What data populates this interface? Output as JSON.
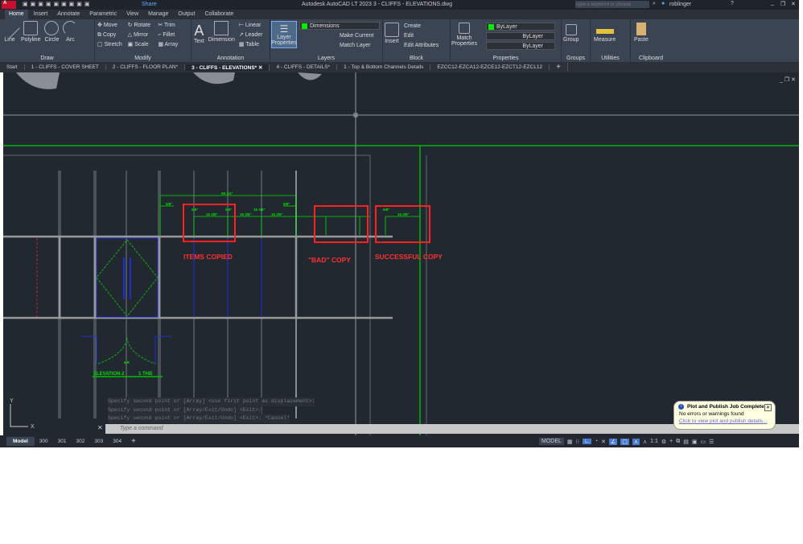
{
  "app": {
    "title": "Autodesk AutoCAD LT 2023   3 - CLIFFS - ELEVATIONS.dwg",
    "share": "Share",
    "search_placeholder": "Type a keyword or phrase",
    "user": "roblinger"
  },
  "ribbon_tabs": [
    "Home",
    "Insert",
    "Annotate",
    "Parametric",
    "View",
    "Manage",
    "Output",
    "Collaborate"
  ],
  "panels": {
    "draw": {
      "title": "Draw",
      "items": [
        "Line",
        "Polyline",
        "Circle",
        "Arc"
      ]
    },
    "modify": {
      "title": "Modify",
      "items": [
        "Move",
        "Rotate",
        "Trim",
        "Copy",
        "Mirror",
        "Fillet",
        "Stretch",
        "Scale",
        "Array"
      ]
    },
    "annotation": {
      "title": "Annotation",
      "items": [
        "Text",
        "Dimension",
        "Linear",
        "Leader",
        "Table"
      ]
    },
    "layers": {
      "title": "Layers",
      "layer_props": "Layer Properties",
      "current_layer": "Dimensions",
      "make_current": "Make Current",
      "match_layer": "Match Layer"
    },
    "block": {
      "title": "Block",
      "items": [
        "Insert",
        "Create",
        "Edit",
        "Edit Attributes"
      ]
    },
    "properties": {
      "title": "Properties",
      "match": "Match Properties",
      "color": "ByLayer",
      "linetype": "ByLayer",
      "lineweight": "ByLayer",
      "color_swatch": "#00e000"
    },
    "groups": {
      "title": "Groups",
      "group": "Group"
    },
    "utilities": {
      "title": "Utilities",
      "measure": "Measure"
    },
    "clipboard": {
      "title": "Clipboard",
      "paste": "Paste"
    }
  },
  "file_tabs": [
    "Start",
    "1 - CLIFFS - COVER SHEET",
    "2 - CLIFFS - FLOOR PLAN*",
    "3 - CLIFFS - ELEVATIONS*",
    "4 - CLIFFS - DETAILS*",
    "1 - Top & Bottom Channels Details",
    "EZCC12-EZCA12-EZCE12-EZCT12-EZCL12"
  ],
  "active_file_tab": 3,
  "drawing": {
    "annotations": {
      "items_copied": "ITEMS COPIED",
      "bad_copy": "\"BAD\" COPY",
      "successful_copy": "SUCCESSFUL COPY"
    },
    "dims": {
      "overall": "89 1/4\"",
      "left": "5/8\"",
      "right": "5/8\"",
      "small": "5/8\"",
      "seg": "15 3/8\""
    },
    "elevation_label": "ELEVATION 2",
    "elevation_scale": "1 THB",
    "door_tag": "MR",
    "ucs": {
      "x": "X",
      "y": "Y"
    },
    "accent_red": "#ff2020",
    "dim_green": "#00e000"
  },
  "command": {
    "history": [
      "Specify second point or [Array] <use first point as displacement>:",
      "Specify second point or [Array/Exit/Undo] <Exit>:",
      "Specify second point or [Array/Exit/Undo] <Exit>: *Cancel*"
    ],
    "placeholder": "Type a command"
  },
  "layout_tabs": [
    "Model",
    "300",
    "301",
    "302",
    "303",
    "304"
  ],
  "status": {
    "model": "MODEL",
    "scale": "1:1"
  },
  "notification": {
    "title": "Plot and Publish Job Complete",
    "body": "No errors or warnings found",
    "link": "Click to view plot and publish details..."
  }
}
